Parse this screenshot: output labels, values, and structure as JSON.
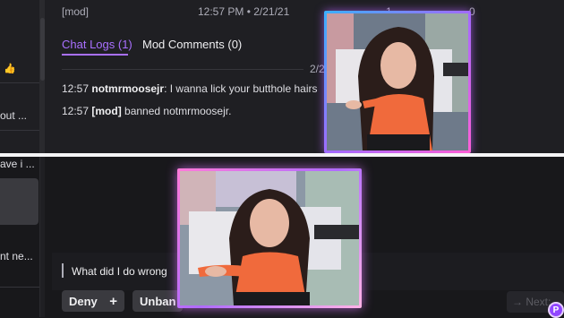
{
  "header": {
    "mod_label": "[mod]",
    "timestamp": "12:57 PM • 2/21/21",
    "count_a": "1",
    "count_b": "0"
  },
  "tabs": [
    {
      "label": "Chat Logs (1)",
      "active": true
    },
    {
      "label": "Mod Comments (0)",
      "active": false
    }
  ],
  "date_marker": "2/2",
  "chat_logs": [
    {
      "time": "12:57",
      "user": "notmrmoosejr",
      "message": ": I wanna lick your butthole hairs"
    },
    {
      "time": "12:57",
      "user": "[mod]",
      "message": " banned notmrmoosejr."
    }
  ],
  "left_snippets": {
    "emoji": "👍",
    "out": "out ...",
    "ave": "ave i ...",
    "ne": "nt ne..."
  },
  "unban_request": {
    "message": "What did I do wrong"
  },
  "actions": {
    "deny_label": "Deny",
    "deny_icon": "+",
    "unban_label": "Unban",
    "next_label": "→  Next:"
  },
  "avatar_letter": "P",
  "colors": {
    "accent": "#a970ff",
    "background": "#18181b"
  }
}
